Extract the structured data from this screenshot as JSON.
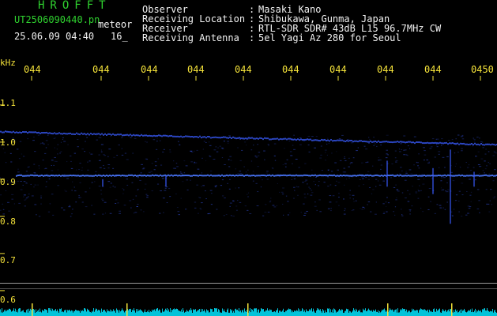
{
  "header": {
    "title": "HROFFT",
    "filename": "UT2506090440.pn",
    "tag": "meteor",
    "datetime": "25.06.09 04:40",
    "counter": "16_"
  },
  "info": [
    {
      "label": "Observer",
      "sep": ":",
      "value": "Masaki Kano"
    },
    {
      "label": "Receiving Location",
      "sep": ":",
      "value": "Shibukawa, Gunma, Japan"
    },
    {
      "label": "Receiver",
      "sep": ":",
      "value": "RTL-SDR SDR# 43dB L15 96.7MHz CW"
    },
    {
      "label": "Receiving Antenna",
      "sep": ":",
      "value": "5el Yagi Az 280 for Seoul"
    }
  ],
  "spectrogram": {
    "unit": "kHz",
    "y_ticks": [
      "1.1",
      "1.0",
      "0.9",
      "0.8",
      "0.7",
      "0.6"
    ],
    "y_tick_values": [
      1.1,
      1.0,
      0.9,
      0.8,
      0.7,
      0.6
    ],
    "x_ticks": [
      "044",
      "044",
      "044",
      "044",
      "044",
      "044",
      "044",
      "044",
      "044",
      "0450"
    ],
    "y_range": [
      0.57,
      1.17
    ],
    "colors": {
      "background": "#000000",
      "signal": "#3a5cff",
      "noise_floor": "#00e5ff",
      "spike": "#f5e33a"
    }
  }
}
